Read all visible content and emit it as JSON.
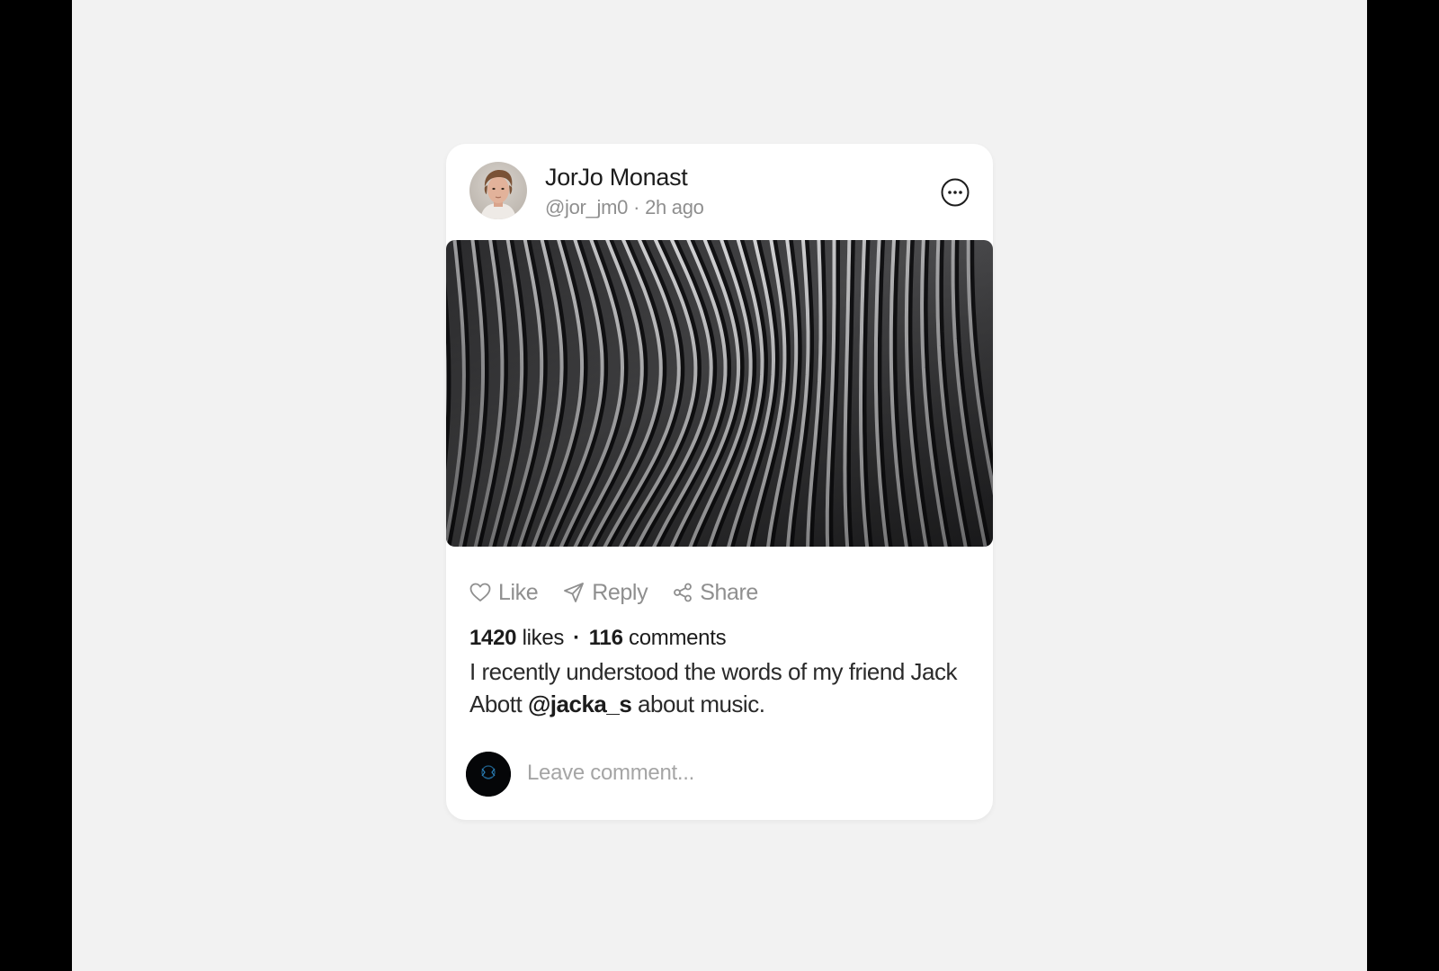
{
  "post": {
    "author": {
      "name": "JorJo Monast",
      "handle": "@jor_jm0",
      "separator": "·",
      "time": "2h ago"
    },
    "more_icon": "more-horizontal-circle-icon",
    "image_alt": "Abstract wavy grey ridges",
    "actions": {
      "like": {
        "label": "Like",
        "icon": "heart-icon"
      },
      "reply": {
        "label": "Reply",
        "icon": "send-icon"
      },
      "share": {
        "label": "Share",
        "icon": "share-icon"
      }
    },
    "stats": {
      "likes_count": "1420",
      "likes_label": "likes",
      "separator": "·",
      "comments_count": "116",
      "comments_label": "comments"
    },
    "caption": {
      "text_before": "I recently understood the words of my friend Jack Abott",
      "mention": "@jacka_s",
      "text_after": "about music."
    },
    "comment": {
      "placeholder": "Leave comment...",
      "value": ""
    }
  },
  "colors": {
    "background": "#f2f2f2",
    "card": "#ffffff",
    "text_primary": "#1c1c1c",
    "text_muted": "#8f8f8f"
  }
}
